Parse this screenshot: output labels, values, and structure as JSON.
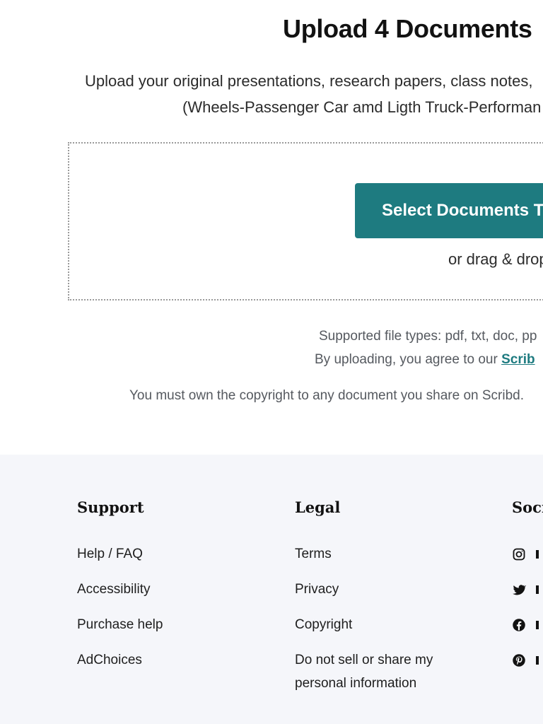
{
  "upload": {
    "title": "Upload 4 Documents",
    "desc_line1": "Upload your original presentations, research papers, class notes,",
    "desc_line2": "(Wheels-Passenger Car amd Ligth Truck-Performan",
    "select_button": "Select Documents T",
    "drag_text": "or drag & drop",
    "file_types": "Supported file types: pdf, txt, doc, pp",
    "agree_prefix": "By uploading, you agree to our ",
    "agree_link": "Scrib",
    "copyright_note": "You must own the copyright to any document you share on Scribd."
  },
  "footer": {
    "support": {
      "heading": "Support",
      "items": [
        "Help / FAQ",
        "Accessibility",
        "Purchase help",
        "AdChoices"
      ]
    },
    "legal": {
      "heading": "Legal",
      "items": [
        "Terms",
        "Privacy",
        "Copyright",
        "Do not sell or share my personal information"
      ]
    },
    "social": {
      "heading": "Soci",
      "icons": [
        "instagram-icon",
        "twitter-icon",
        "facebook-icon",
        "pinterest-icon"
      ]
    }
  },
  "colors": {
    "brand": "#1e7b80",
    "footer_bg": "#f5f6fa"
  }
}
